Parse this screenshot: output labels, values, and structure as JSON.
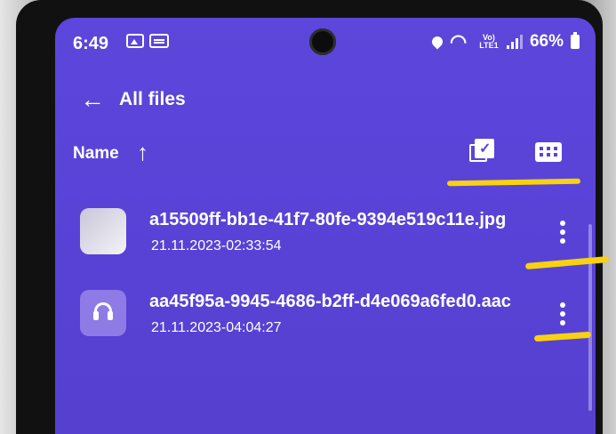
{
  "status_bar": {
    "time": "6:49",
    "battery_percent": "66%",
    "network": "Vo) LTE1",
    "icons": [
      "gallery-icon",
      "message-icon",
      "location-icon",
      "wifi-icon",
      "signal-icon",
      "battery-icon"
    ]
  },
  "header": {
    "title": "All files",
    "back_icon": "arrow-left-icon"
  },
  "toolbar": {
    "sort_label": "Name",
    "sort_direction": "ascending",
    "select_icon": "select-multiple-icon",
    "view_icon": "grid-view-icon"
  },
  "files": [
    {
      "name": "a15509ff-bb1e-41f7-80fe-9394e519c11e.jpg",
      "date": "21.11.2023-02:33:54",
      "type": "image"
    },
    {
      "name": "aa45f95a-9945-4686-b2ff-d4e069a6fed0.aac",
      "date": "21.11.2023-04:04:27",
      "type": "audio"
    }
  ],
  "colors": {
    "screen_background": "#5b45d9",
    "highlight_marks": "#f8d20e",
    "text": "#ffffff"
  }
}
